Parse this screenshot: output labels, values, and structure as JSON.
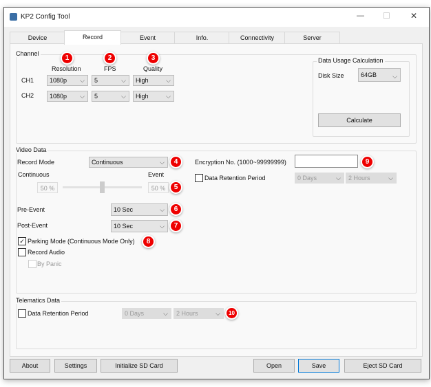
{
  "window": {
    "title": "KP2 Config Tool",
    "minimize": "—",
    "maximize": "☐",
    "close": "✕"
  },
  "tabs": [
    "Device",
    "Record",
    "Event",
    "Info.",
    "Connectivity",
    "Server"
  ],
  "channel": {
    "label": "Channel",
    "headers": [
      "Resolution",
      "FPS",
      "Quality"
    ],
    "badges": [
      "1",
      "2",
      "3"
    ],
    "rows": [
      {
        "name": "CH1",
        "resolution": "1080p",
        "fps": "5",
        "quality": "High"
      },
      {
        "name": "CH2",
        "resolution": "1080p",
        "fps": "5",
        "quality": "High"
      }
    ]
  },
  "data_usage": {
    "label": "Data Usage Calculation",
    "disk_size_label": "Disk Size",
    "disk_size": "64GB",
    "calculate": "Calculate"
  },
  "video": {
    "label": "Video Data",
    "record_mode_label": "Record Mode",
    "record_mode": "Continuous",
    "continuous_label": "Continuous",
    "event_label": "Event",
    "continuous_pct": "50 %",
    "event_pct": "50 %",
    "slider_value_percent": 50,
    "pre_event_label": "Pre-Event",
    "pre_event": "10 Sec",
    "post_event_label": "Post-Event",
    "post_event": "10 Sec",
    "parking_label": "Parking Mode (Continuous Mode Only)",
    "parking_checked": true,
    "record_audio_label": "Record Audio",
    "by_panic_label": "By Panic",
    "encryption_label": "Encryption No. (1000~99999999)",
    "encryption_value": "",
    "retention_label": "Data Retention Period",
    "retention_days": "0 Days",
    "retention_hours": "2 Hours",
    "badges": [
      "4",
      "5",
      "6",
      "7",
      "8",
      "9"
    ]
  },
  "telematics": {
    "label": "Telematics Data",
    "retention_label": "Data Retention Period",
    "days": "0 Days",
    "hours": "2 Hours",
    "badge": "10"
  },
  "buttons": {
    "about": "About",
    "settings": "Settings",
    "init_sd": "Initialize SD Card",
    "open": "Open",
    "save": "Save",
    "eject": "Eject SD Card"
  },
  "checkmark": "✓",
  "chevron": "⌵"
}
